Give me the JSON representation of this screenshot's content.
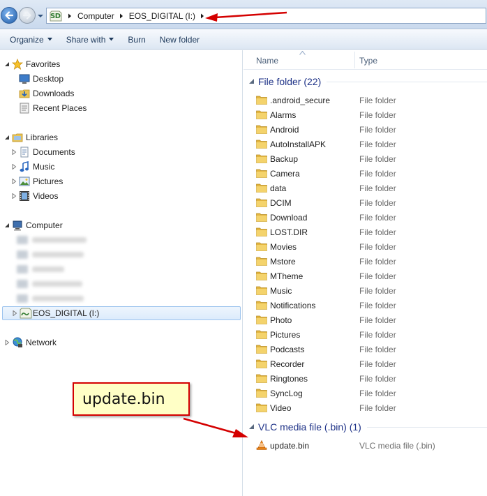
{
  "window": {
    "breadcrumb": [
      "Computer",
      "EOS_DIGITAL (I:)"
    ],
    "drive_badge": "SD"
  },
  "toolbar": {
    "items": [
      {
        "label": "Organize",
        "has_dropdown": true
      },
      {
        "label": "Share with",
        "has_dropdown": true
      },
      {
        "label": "Burn",
        "has_dropdown": false
      },
      {
        "label": "New folder",
        "has_dropdown": false
      }
    ]
  },
  "nav": {
    "favorites": {
      "label": "Favorites",
      "items": [
        "Desktop",
        "Downloads",
        "Recent Places"
      ]
    },
    "libraries": {
      "label": "Libraries",
      "items": [
        "Documents",
        "Music",
        "Pictures",
        "Videos"
      ]
    },
    "computer": {
      "label": "Computer",
      "selected_drive": "EOS_DIGITAL (I:)"
    },
    "network": {
      "label": "Network"
    }
  },
  "columns": {
    "name": "Name",
    "type": "Type"
  },
  "groups": [
    {
      "title": "File folder (22)",
      "items": [
        {
          "name": ".android_secure",
          "type": "File folder"
        },
        {
          "name": "Alarms",
          "type": "File folder"
        },
        {
          "name": "Android",
          "type": "File folder"
        },
        {
          "name": "AutoInstallAPK",
          "type": "File folder"
        },
        {
          "name": "Backup",
          "type": "File folder"
        },
        {
          "name": "Camera",
          "type": "File folder"
        },
        {
          "name": "data",
          "type": "File folder"
        },
        {
          "name": "DCIM",
          "type": "File folder"
        },
        {
          "name": "Download",
          "type": "File folder"
        },
        {
          "name": "LOST.DIR",
          "type": "File folder"
        },
        {
          "name": "Movies",
          "type": "File folder"
        },
        {
          "name": "Mstore",
          "type": "File folder"
        },
        {
          "name": "MTheme",
          "type": "File folder"
        },
        {
          "name": "Music",
          "type": "File folder"
        },
        {
          "name": "Notifications",
          "type": "File folder"
        },
        {
          "name": "Photo",
          "type": "File folder"
        },
        {
          "name": "Pictures",
          "type": "File folder"
        },
        {
          "name": "Podcasts",
          "type": "File folder"
        },
        {
          "name": "Recorder",
          "type": "File folder"
        },
        {
          "name": "Ringtones",
          "type": "File folder"
        },
        {
          "name": "SyncLog",
          "type": "File folder"
        },
        {
          "name": "Video",
          "type": "File folder"
        }
      ]
    },
    {
      "title": "VLC media file (.bin) (1)",
      "items": [
        {
          "name": "update.bin",
          "type": "VLC media file (.bin)",
          "icon": "vlc-cone-icon"
        }
      ]
    }
  ],
  "callout": {
    "text": "update.bin"
  },
  "colors": {
    "annotation": "#d40000",
    "group_title": "#1e3287",
    "callout_fill": "#ffffc6"
  }
}
